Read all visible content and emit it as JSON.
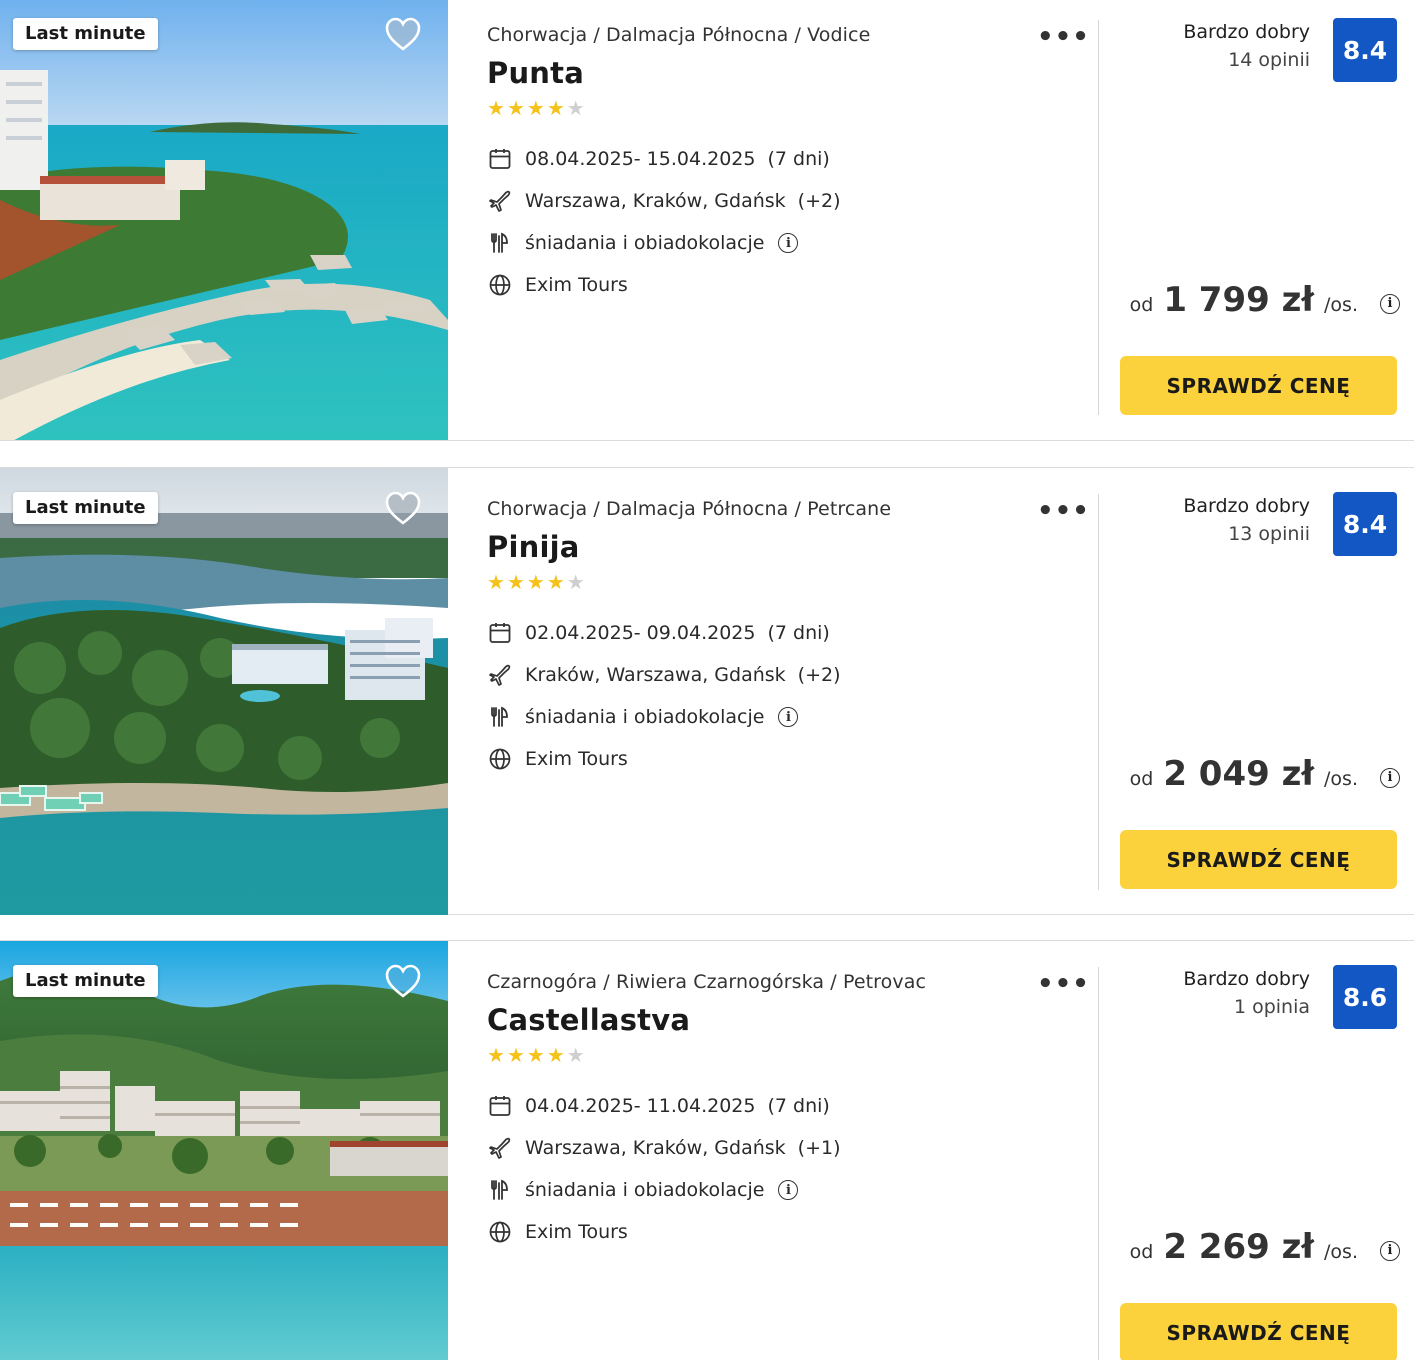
{
  "offers": [
    {
      "badge": "Last minute",
      "breadcrumb": "Chorwacja / Dalmacja Północna / Vodice",
      "name": "Punta",
      "stars_filled": 4,
      "stars_total": 5,
      "dates": "08.04.2025- 15.04.2025",
      "duration": "(7 dni)",
      "departures": "Warszawa, Kraków, Gdańsk",
      "departures_more": "(+2)",
      "board": "śniadania i obiadokolacje",
      "operator": "Exim Tours",
      "rating_label": "Bardzo dobry",
      "reviews": "14 opinii",
      "score": "8.4",
      "price_prefix": "od",
      "price": "1 799 zł",
      "price_suffix": "/os.",
      "cta": "SPRAWDŹ CENĘ"
    },
    {
      "badge": "Last minute",
      "breadcrumb": "Chorwacja / Dalmacja Północna / Petrcane",
      "name": "Pinija",
      "stars_filled": 4,
      "stars_total": 5,
      "dates": "02.04.2025- 09.04.2025",
      "duration": "(7 dni)",
      "departures": "Kraków, Warszawa, Gdańsk",
      "departures_more": "(+2)",
      "board": "śniadania i obiadokolacje",
      "operator": "Exim Tours",
      "rating_label": "Bardzo dobry",
      "reviews": "13 opinii",
      "score": "8.4",
      "price_prefix": "od",
      "price": "2 049 zł",
      "price_suffix": "/os.",
      "cta": "SPRAWDŹ CENĘ"
    },
    {
      "badge": "Last minute",
      "breadcrumb": "Czarnogóra / Riwiera Czarnogórska / Petrovac",
      "name": "Castellastva",
      "stars_filled": 4,
      "stars_total": 5,
      "dates": "04.04.2025- 11.04.2025",
      "duration": "(7 dni)",
      "departures": "Warszawa, Kraków, Gdańsk",
      "departures_more": "(+1)",
      "board": "śniadania i obiadokolacje",
      "operator": "Exim Tours",
      "rating_label": "Bardzo dobry",
      "reviews": "1 opinia",
      "score": "8.6",
      "price_prefix": "od",
      "price": "2 269 zł",
      "price_suffix": "/os.",
      "cta": "SPRAWDŹ CENĘ"
    }
  ],
  "colors": {
    "star": "#f5c21b",
    "score_bg": "#1257c4",
    "cta_bg": "#fcd23c"
  }
}
